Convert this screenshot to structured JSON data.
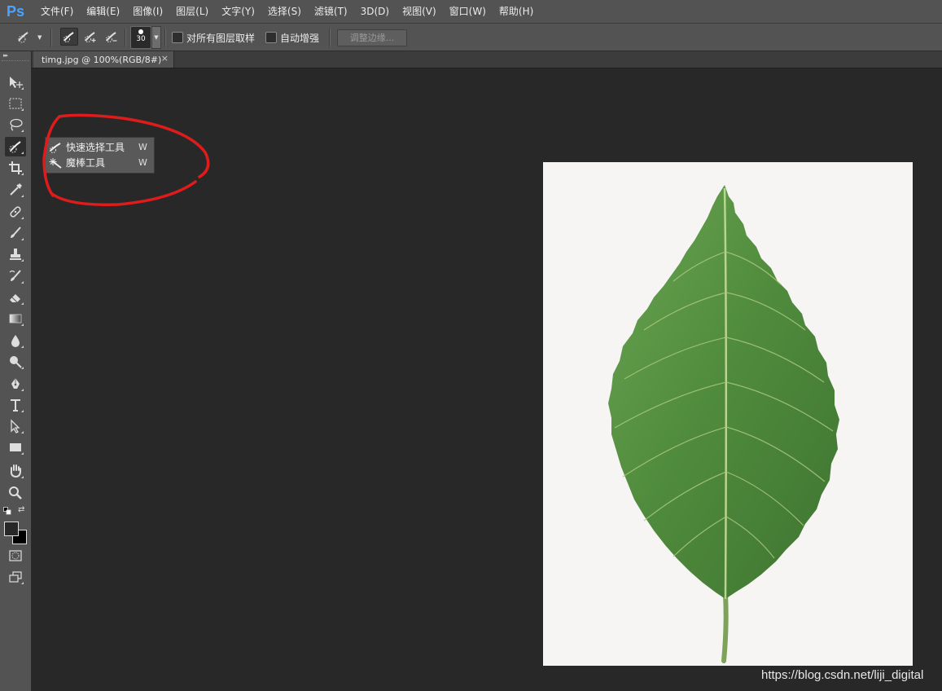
{
  "app": {
    "logo": "Ps"
  },
  "menu": {
    "items": [
      "文件(F)",
      "编辑(E)",
      "图像(I)",
      "图层(L)",
      "文字(Y)",
      "选择(S)",
      "滤镜(T)",
      "3D(D)",
      "视图(V)",
      "窗口(W)",
      "帮助(H)"
    ]
  },
  "options_bar": {
    "brush_size": "30",
    "sample_all_layers_label": "对所有图层取样",
    "auto_enhance_label": "自动增强",
    "refine_edge_label": "调整边缘..."
  },
  "document": {
    "tab_title": "timg.jpg @ 100%(RGB/8#)",
    "close_glyph": "×"
  },
  "tool_flyout": {
    "items": [
      {
        "label": "快速选择工具",
        "shortcut": "W",
        "icon": "quick-selection-icon"
      },
      {
        "label": "魔棒工具",
        "shortcut": "W",
        "icon": "magic-wand-icon"
      }
    ]
  },
  "toolbar": {
    "tools": [
      "move-icon",
      "marquee-icon",
      "lasso-icon",
      "quick-selection-icon",
      "crop-icon",
      "eyedropper-icon",
      "healing-brush-icon",
      "brush-icon",
      "clone-stamp-icon",
      "history-brush-icon",
      "eraser-icon",
      "gradient-icon",
      "blur-icon",
      "dodge-icon",
      "pen-icon",
      "type-icon",
      "path-selection-icon",
      "rectangle-icon",
      "hand-icon",
      "zoom-icon"
    ],
    "collapse_glyph": "▸▸"
  },
  "colors": {
    "foreground": "#282828",
    "background": "#000000",
    "annotation": "#e01b1b",
    "leaf_green": "#4f8a3c"
  },
  "watermark": "https://blog.csdn.net/liji_digital"
}
